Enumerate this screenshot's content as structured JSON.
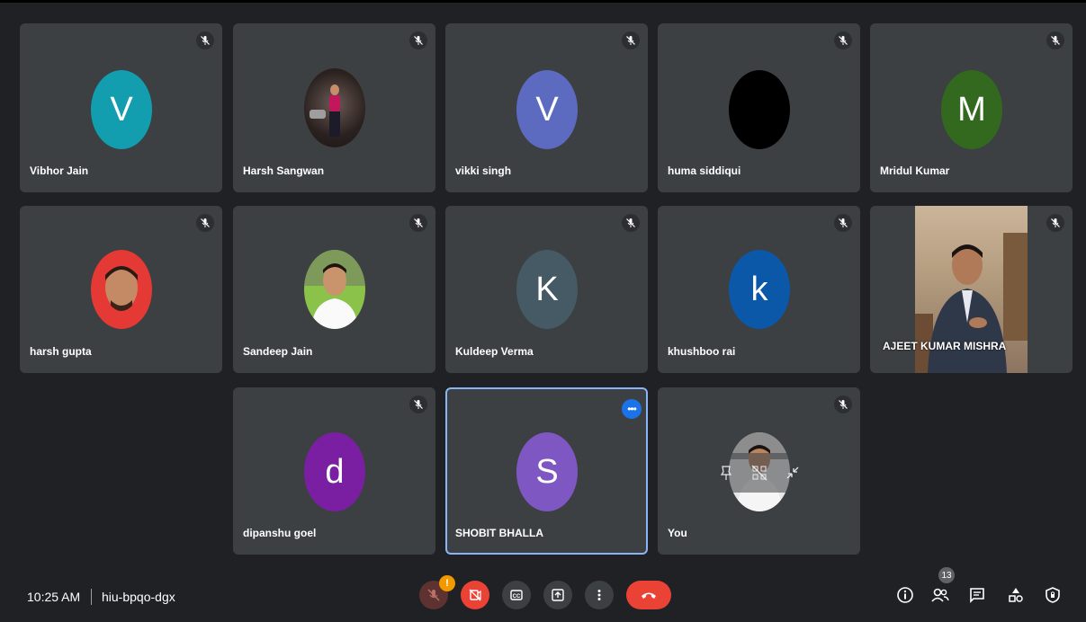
{
  "participants": [
    {
      "name": "Vibhor Jain",
      "initial": "V",
      "color": "#129eaf"
    },
    {
      "name": "Harsh Sangwan"
    },
    {
      "name": "vikki singh",
      "initial": "V",
      "color": "#5c6bc0"
    },
    {
      "name": "huma siddiqui",
      "color": "#000000"
    },
    {
      "name": "Mridul Kumar",
      "initial": "M",
      "color": "#33691e"
    },
    {
      "name": "harsh gupta"
    },
    {
      "name": "Sandeep Jain"
    },
    {
      "name": "Kuldeep Verma",
      "initial": "K",
      "color": "#455a64"
    },
    {
      "name": "khushboo rai",
      "initial": "k",
      "color": "#0b57a8"
    },
    {
      "name": "AJEET KUMAR MISHRA"
    },
    {
      "name": "dipanshu goel",
      "initial": "d",
      "color": "#7b1fa2"
    },
    {
      "name": "SHOBIT BHALLA",
      "initial": "S",
      "color": "#7e57c2"
    },
    {
      "name": "You"
    }
  ],
  "bottom_bar": {
    "time": "10:25 AM",
    "meeting_code": "hiu-bpqo-dgx",
    "mic_warning": "!",
    "people_count": "13"
  },
  "icons": {
    "mute": "mic-off-icon",
    "more": "more-options-icon",
    "captions": "captions-icon",
    "present": "present-screen-icon",
    "end": "end-call-icon",
    "info": "info-icon",
    "people": "people-icon",
    "chat": "chat-icon",
    "activities": "activities-icon",
    "host": "host-controls-icon"
  }
}
